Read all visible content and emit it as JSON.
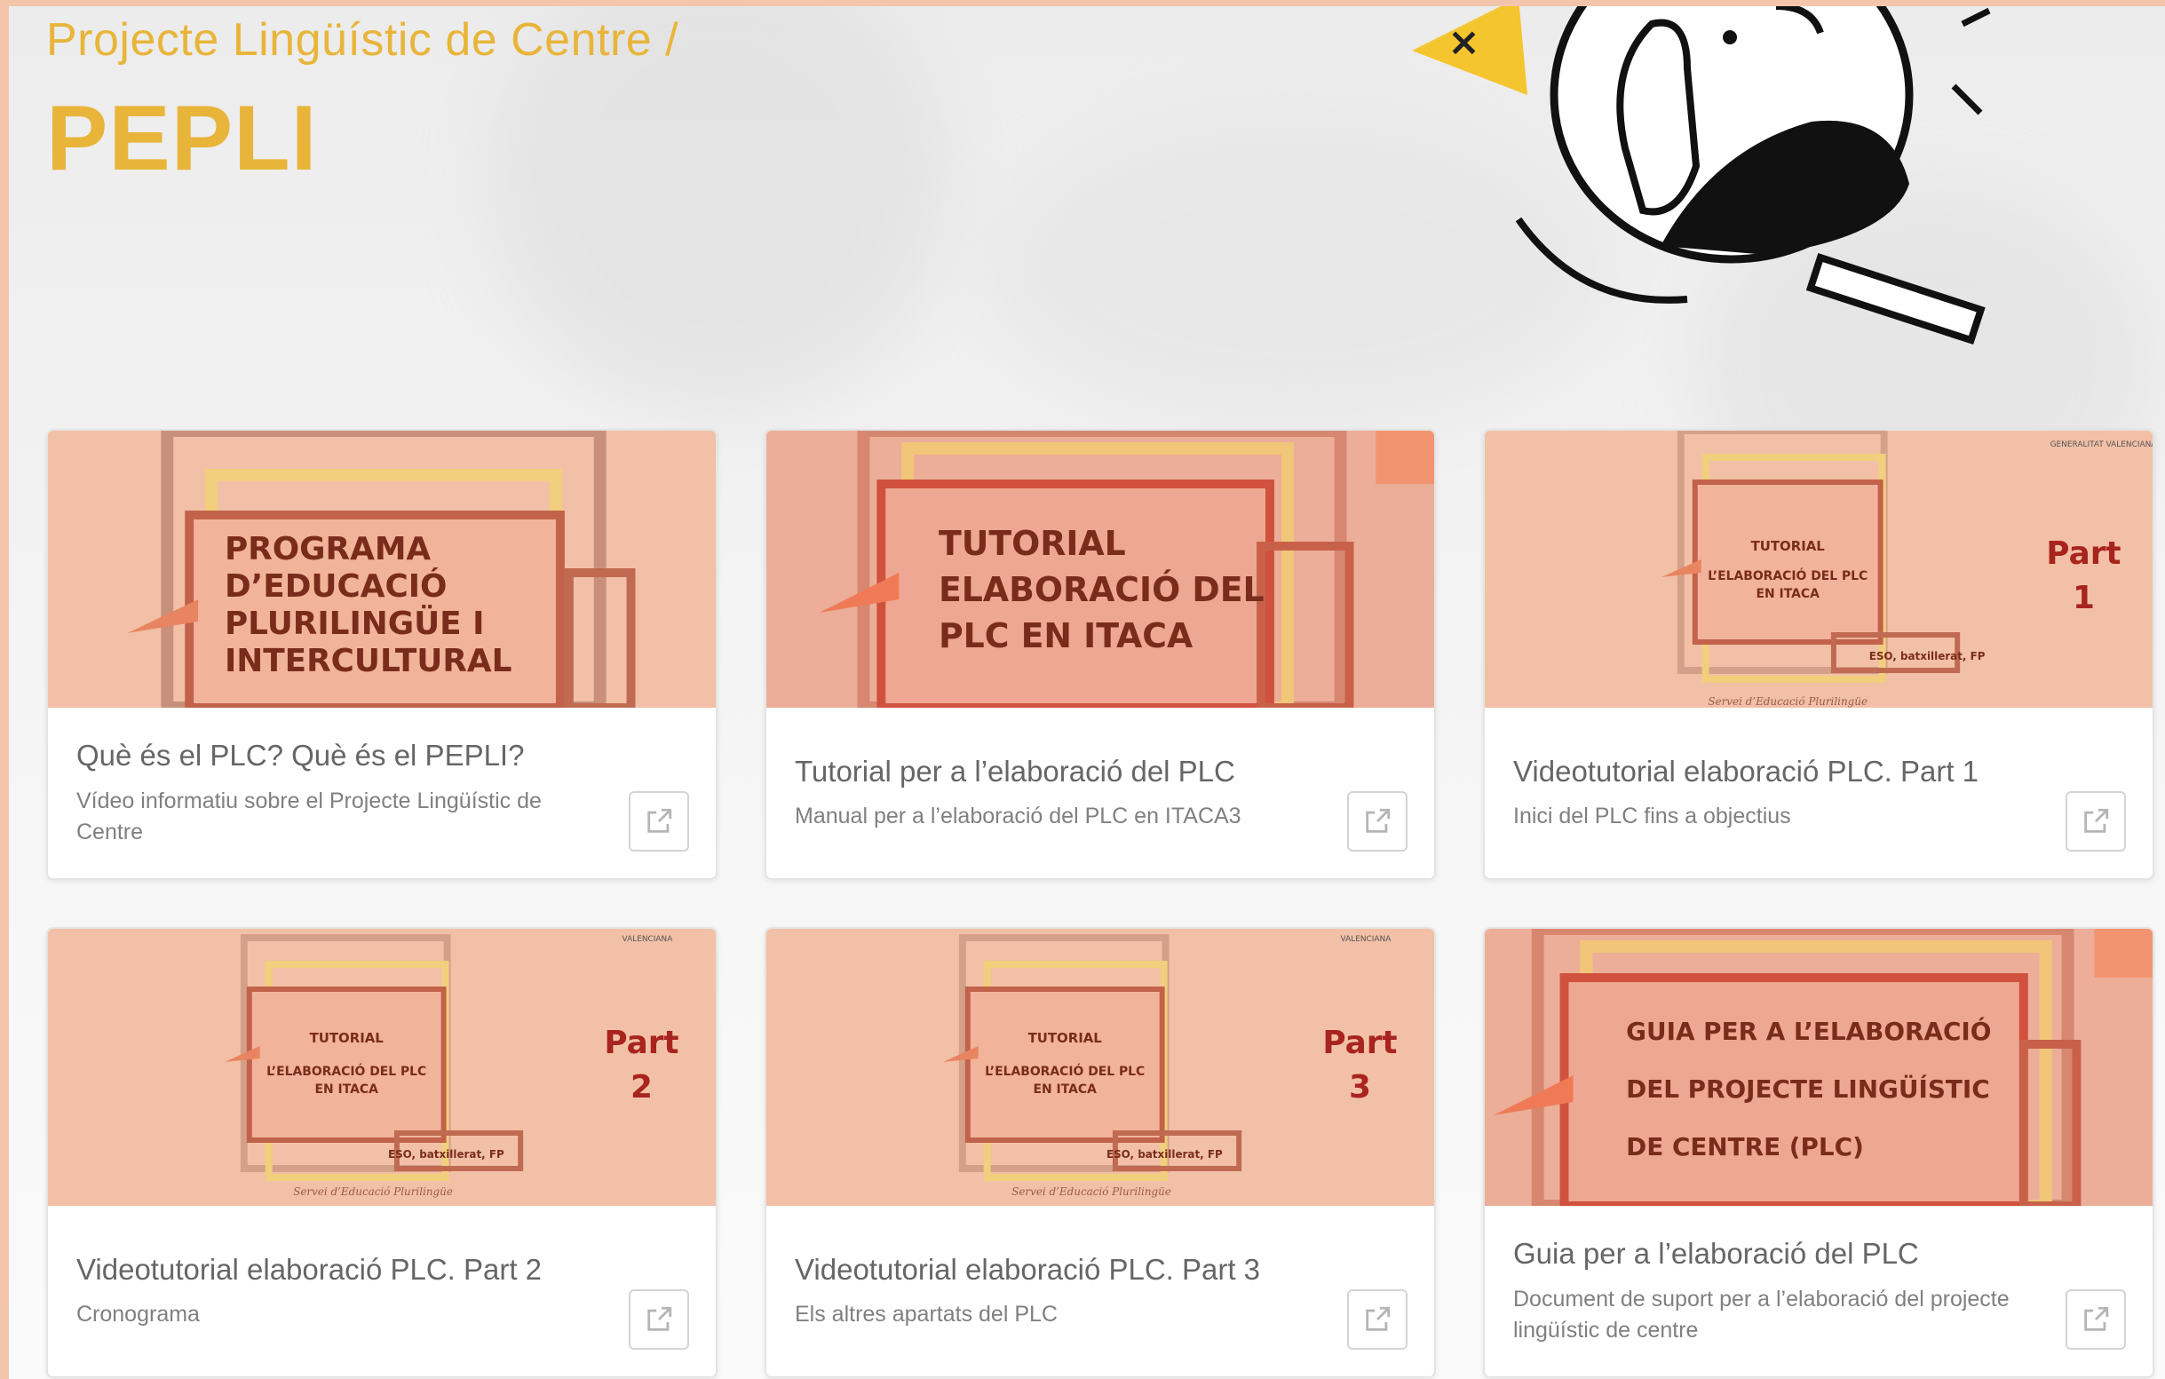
{
  "header": {
    "breadcrumb": "Projecte Lingüístic de Centre /",
    "title": "PEPLI"
  },
  "colors": {
    "accent": "#e8b53a",
    "frame": "#f3c6ac",
    "thumb_bg": "#f2c0a6"
  },
  "cards": [
    {
      "title": "Què és el PLC? Què és el PEPLI?",
      "description": "Vídeo informatiu sobre el Projecte Lingüístic de Centre",
      "thumb_lines": [
        "PROGRAMA",
        "D’EDUCACIÓ",
        "PLURILINGÜE I",
        "INTERCULTURAL"
      ],
      "icon": "external-link-icon"
    },
    {
      "title": "Tutorial per a l’elaboració del PLC",
      "description": "Manual per a l’elaboració del PLC en ITACA3",
      "thumb_lines": [
        "TUTORIAL",
        "ELABORACIÓ DEL",
        "PLC EN ITACA"
      ],
      "icon": "external-link-icon"
    },
    {
      "title": "Videotutorial elaboració PLC. Part 1",
      "description": "Inici del PLC fins a objectius",
      "thumb_lines": [
        "TUTORIAL",
        "L’ELABORACIÓ DEL PLC",
        "EN ITACA",
        "ESO, batxillerat, FP"
      ],
      "thumb_part": [
        "Part",
        "1"
      ],
      "thumb_footer": "Servei d’Educació Plurilingüe",
      "thumb_logo": "GENERALITAT VALENCIANA",
      "icon": "external-link-icon"
    },
    {
      "title": "Videotutorial elaboració PLC. Part 2",
      "description": "Cronograma",
      "thumb_lines": [
        "TUTORIAL",
        "L’ELABORACIÓ DEL PLC",
        "EN ITACA",
        "ESO, batxillerat, FP"
      ],
      "thumb_part": [
        "Part",
        "2"
      ],
      "thumb_footer": "Servei d’Educació Plurilingüe",
      "thumb_logo": "VALENCIANA",
      "icon": "external-link-icon"
    },
    {
      "title": "Videotutorial elaboració PLC. Part 3",
      "description": "Els altres apartats del PLC",
      "thumb_lines": [
        "TUTORIAL",
        "L’ELABORACIÓ DEL PLC",
        "EN ITACA",
        "ESO, batxillerat, FP"
      ],
      "thumb_part": [
        "Part",
        "3"
      ],
      "thumb_footer": "Servei d’Educació Plurilingüe",
      "thumb_logo": "VALENCIANA",
      "icon": "external-link-icon"
    },
    {
      "title": "Guia per a l’elaboració del PLC",
      "description": "Document de suport per a l’elaboració del projecte lingüístic de centre",
      "thumb_lines": [
        "GUIA PER A L’ELABORACIÓ",
        "DEL PROJECTE LINGÜÍSTIC",
        "DE CENTRE (PLC)"
      ],
      "icon": "external-link-icon"
    }
  ]
}
